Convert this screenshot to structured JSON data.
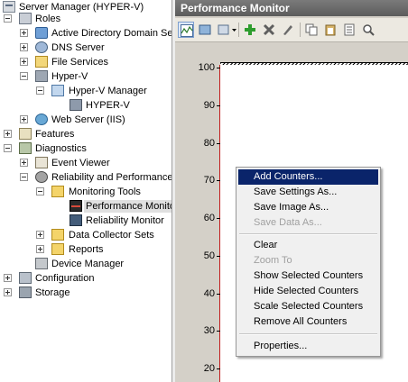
{
  "tree": {
    "server_manager": "Server Manager (HYPER-V)",
    "roles": "Roles",
    "active_directory": "Active Directory Domain Se",
    "dns_server": "DNS Server",
    "file_services": "File Services",
    "hyperv": "Hyper-V",
    "hyperv_manager": "Hyper-V Manager",
    "hyperv_host": "HYPER-V",
    "web_server": "Web Server (IIS)",
    "features": "Features",
    "diagnostics": "Diagnostics",
    "event_viewer": "Event Viewer",
    "reliability_perf": "Reliability and Performance",
    "monitoring_tools": "Monitoring Tools",
    "performance_monitor": "Performance Monito",
    "reliability_monitor": "Reliability Monitor",
    "data_collector_sets": "Data Collector Sets",
    "reports": "Reports",
    "device_manager": "Device Manager",
    "configuration": "Configuration",
    "storage": "Storage"
  },
  "pane": {
    "title": "Performance Monitor"
  },
  "chart_data": {
    "type": "line",
    "yticks": [
      "100",
      "90",
      "80",
      "70",
      "60",
      "50",
      "40",
      "30",
      "20"
    ],
    "ylim": [
      0,
      100
    ]
  },
  "menu": {
    "add_counters": "Add Counters...",
    "save_settings": "Save Settings As...",
    "save_image": "Save Image As...",
    "save_data": "Save Data As...",
    "clear": "Clear",
    "zoom_to": "Zoom To",
    "show_selected": "Show Selected Counters",
    "hide_selected": "Hide Selected Counters",
    "scale_selected": "Scale Selected Counters",
    "remove_all": "Remove All Counters",
    "properties": "Properties..."
  }
}
